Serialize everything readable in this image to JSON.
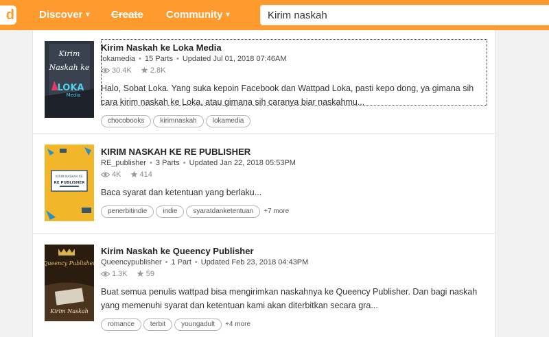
{
  "header": {
    "logo_text": "d",
    "nav": [
      {
        "label": "Discover",
        "has_caret": true
      },
      {
        "label": "Create",
        "has_caret": false
      },
      {
        "label": "Community",
        "has_caret": true
      }
    ],
    "caret": "▾",
    "search_value": "Kirim naskah",
    "brand_color": "#ff9a2e"
  },
  "results": [
    {
      "title": "Kirim Naskah ke Loka Media",
      "author": "lokamedia",
      "parts": "15 Parts",
      "updated": "Updated Jul 01, 2018 07:46AM",
      "reads": "30.4K",
      "votes": "2.8K",
      "description": "Halo, Sobat Loka. Yang suka kepoin Facebook dan Wattpad Loka, pasti kepo dong, ya gimana sih cara kirim naskah ke Loka, atau gimana sih caranya biar naskahmu...",
      "tags": [
        "chocobooks",
        "kirimnaskah",
        "lokamedia"
      ],
      "more": "",
      "cover_text": [
        "Kirim",
        "Naskah ke",
        "LOKA",
        "Media"
      ]
    },
    {
      "title": "KIRIM NASKAH KE RE PUBLISHER",
      "author": "RE_publisher",
      "parts": "3 Parts",
      "updated": "Updated Jan 22, 2018 05:53PM",
      "reads": "4K",
      "votes": "414",
      "description": "Baca syarat dan ketentuan yang berlaku...",
      "tags": [
        "penerbitindie",
        "indie",
        "syaratdanketentuan"
      ],
      "more": "+7 more",
      "cover_text": [
        "KIRIM NASKAH KE",
        "RE PUBLISHER"
      ]
    },
    {
      "title": "Kirim Naskah ke Queency Publisher",
      "author": "Queencypublisher",
      "parts": "1 Part",
      "updated": "Updated Feb 23, 2018 04:43PM",
      "reads": "1.3K",
      "votes": "59",
      "description": "Buat semua penulis wattpad bisa mengirimkan naskahnya ke Queency Publisher. Dan bagi naskah yang memenuhi syarat dan ketentuan kami akan diterbitkan secara gra...",
      "tags": [
        "romance",
        "terbit",
        "youngadult"
      ],
      "more": "+4 more",
      "cover_text": [
        "Queency Publisher",
        "Kirim Naskah"
      ]
    }
  ]
}
